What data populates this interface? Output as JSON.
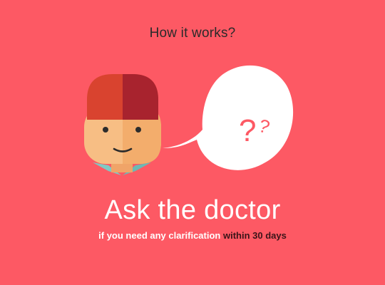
{
  "header": {
    "title": "How it works?"
  },
  "illustration": {
    "person_icon": "doctor-avatar-icon",
    "bubble_icon": "speech-bubble-question-icon",
    "bubble_text": "?",
    "bubble_text_small": "?"
  },
  "main": {
    "heading": "Ask the doctor",
    "subline_part1": "if you need any clarification",
    "subline_part2": "within 30 days"
  },
  "colors": {
    "background": "#fd5964",
    "question_marks": "#fd5964",
    "highlight_text": "#3a1418"
  }
}
